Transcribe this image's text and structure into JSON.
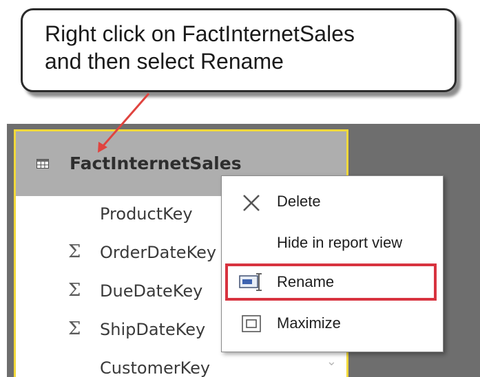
{
  "callout": {
    "line1": "Right click on FactInternetSales",
    "line2": "and then select Rename"
  },
  "table_card": {
    "title": "FactInternetSales",
    "icon": "table-icon",
    "fields": [
      {
        "name": "ProductKey",
        "aggregate": ""
      },
      {
        "name": "OrderDateKey",
        "aggregate": "Σ"
      },
      {
        "name": "DueDateKey",
        "aggregate": "Σ"
      },
      {
        "name": "ShipDateKey",
        "aggregate": "Σ"
      },
      {
        "name": "CustomerKey",
        "aggregate": ""
      }
    ]
  },
  "context_menu": {
    "items": [
      {
        "label": "Delete",
        "icon": "delete-x-icon"
      },
      {
        "label": "Hide in report view",
        "icon": ""
      },
      {
        "label": "Rename",
        "icon": "rename-icon",
        "highlighted": true
      },
      {
        "label": "Maximize",
        "icon": "maximize-icon"
      }
    ]
  },
  "colors": {
    "canvas": "#6e6e6e",
    "card_border": "#f2d93b",
    "card_header": "#aeaeae",
    "highlight": "#d8333f",
    "arrow": "#e0443f"
  }
}
